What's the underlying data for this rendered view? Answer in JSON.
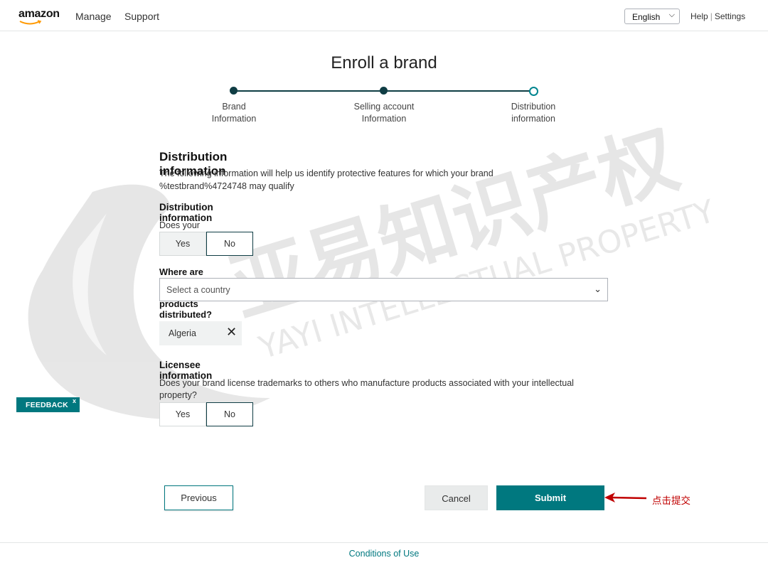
{
  "header": {
    "logo_text": "amazon",
    "nav": [
      "Manage",
      "Support"
    ],
    "language": "English",
    "help": "Help",
    "settings": "Settings"
  },
  "page_title": "Enroll a brand",
  "stepper": {
    "steps": [
      {
        "line1": "Brand",
        "line2": "Information",
        "state": "complete"
      },
      {
        "line1": "Selling account",
        "line2": "Information",
        "state": "complete"
      },
      {
        "line1": "Distribution",
        "line2": "information",
        "state": "current"
      }
    ]
  },
  "form": {
    "section_title": "Distribution information",
    "description": "The following information will help us identify protective features for which your brand %testbrand%4724748 may qualify",
    "distribution": {
      "heading": "Distribution information",
      "question": "Does your brand sell to distributors?",
      "yes": "Yes",
      "no": "No",
      "selected": "No"
    },
    "countries": {
      "question": "Where are your brand’s products distributed?",
      "placeholder": "Select a country",
      "selected_chip": "Algeria",
      "chip_remove": "✕"
    },
    "licensee": {
      "heading": "Licensee information",
      "question": "Does your brand license trademarks to others who manufacture products associated with your intellectual property?",
      "yes": "Yes",
      "no": "No",
      "selected": "No"
    }
  },
  "feedback": {
    "label": "FEEDBACK",
    "close": "x"
  },
  "buttons": {
    "previous": "Previous",
    "cancel": "Cancel",
    "submit": "Submit"
  },
  "annotation": {
    "text": "点击提交",
    "color": "#c00000"
  },
  "watermark": {
    "cn": "亚易知识产权",
    "en": "YAYI INTELLECTUAL PROPERTY"
  },
  "footer": {
    "link": "Conditions of Use"
  },
  "colors": {
    "accent": "#00787f",
    "dark_step": "#0f3d44"
  }
}
